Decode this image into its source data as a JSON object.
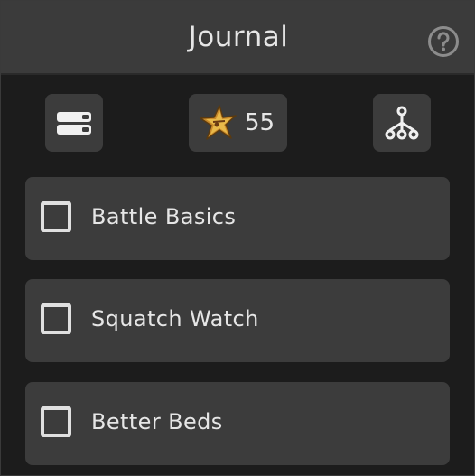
{
  "header": {
    "title": "Journal",
    "help_icon": "question-circle-icon"
  },
  "toolbar": {
    "list_icon": "list-view-icon",
    "star_icon": "gold-star-icon",
    "star_count": "55",
    "tree_icon": "hierarchy-tree-icon"
  },
  "quests": [
    {
      "label": "Battle Basics",
      "checked": false
    },
    {
      "label": "Squatch Watch",
      "checked": false
    },
    {
      "label": "Better Beds",
      "checked": false
    }
  ],
  "colors": {
    "background": "#1c1c1c",
    "header": "#3b3b3b",
    "button": "#3c3c3c",
    "text": "#e6e6e6",
    "gold": "#d9a23a"
  }
}
